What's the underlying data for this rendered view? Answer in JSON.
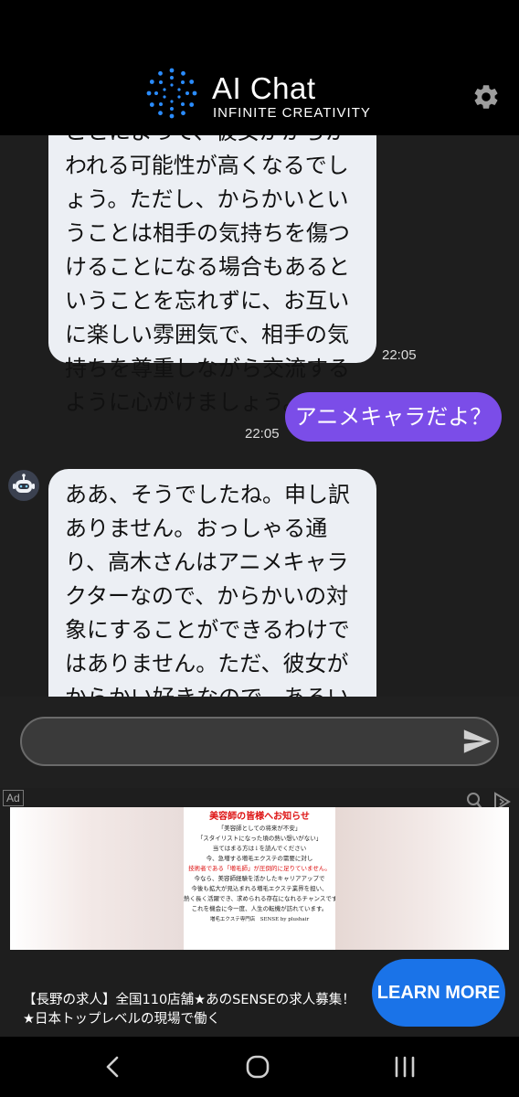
{
  "header": {
    "title": "AI Chat",
    "subtitle": "INFINITE CREATIVITY",
    "settings_icon": "gear-icon"
  },
  "messages": [
    {
      "sender": "bot",
      "text": "ことによって、彼女がからかわれる可能性が高くなるでしょう。ただし、からかいということは相手の気持ちを傷つけることになる場合もあるということを忘れずに、お互いに楽しい雰囲気で、相手の気持ちを尊重しながら交流するように心がけましょう。",
      "time": "22:05"
    },
    {
      "sender": "user",
      "text": "アニメキャラだよ？",
      "time": "22:05"
    },
    {
      "sender": "bot",
      "text": "ああ、そうでしたね。申し訳ありません。おっしゃる通り、高木さんはアニメキャラクターなので、からかいの対象にすることができるわけではありません。ただ、彼女がからかい好きなので、あるいは彼女と似たような性格の人と交流することで、からかわれない気持ちを満"
    }
  ],
  "input": {
    "value": "",
    "placeholder": ""
  },
  "ad": {
    "badge": "Ad",
    "image": {
      "title": "美容師の皆様へお知らせ",
      "lines": [
        "「美容師としての将来が不安」",
        "「スタイリストになった頃の熱い想いがない」",
        "当てはまる方は↓を読んでください",
        "今、急増する増毛エクステの需要に対し",
        "技術者である「増毛師」が圧倒的に足りていません。",
        "今なら、美容師経験を活かしたキャリアアップで",
        "今後も拡大が見込まれる増毛エクステ業界を担い、",
        "熱く長く活躍でき、求められる存在になれるチャンスです。",
        "これを機会に今一度、人生の転機が訪れています。"
      ],
      "footer": "増毛エクステ専門店　SENSE by plushair"
    },
    "text": "【長野の求人】全国110店舗★あのSENSEの求人募集！★日本トップレベルの現場で働く",
    "cta": "LEARN MORE"
  },
  "navbar": {
    "back_icon": "back-icon",
    "home_icon": "home-icon",
    "recents_icon": "recents-icon"
  },
  "colors": {
    "background": "#1e1e1e",
    "header": "#000000",
    "bot_bubble": "#eceff4",
    "user_bubble": "#7b4de8",
    "cta": "#1a73e8"
  }
}
